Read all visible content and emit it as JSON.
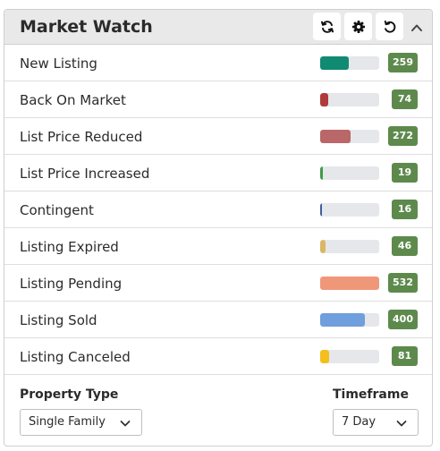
{
  "widget": {
    "title": "Market Watch",
    "header_icons": [
      "refresh-icon",
      "gear-icon",
      "undo-icon",
      "chevron-up-icon"
    ]
  },
  "rows": [
    {
      "label": "New Listing",
      "count": "259",
      "fill": 0.49,
      "color": "#118a72"
    },
    {
      "label": "Back On Market",
      "count": "74",
      "fill": 0.14,
      "color": "#b03a3a"
    },
    {
      "label": "List Price Reduced",
      "count": "272",
      "fill": 0.51,
      "color": "#b96768"
    },
    {
      "label": "List Price Increased",
      "count": "19",
      "fill": 0.04,
      "color": "#3f9b4a"
    },
    {
      "label": "Contingent",
      "count": "16",
      "fill": 0.03,
      "color": "#3d5f9e"
    },
    {
      "label": "Listing Expired",
      "count": "46",
      "fill": 0.09,
      "color": "#d9b766"
    },
    {
      "label": "Listing Pending",
      "count": "532",
      "fill": 1.0,
      "color": "#f0977a"
    },
    {
      "label": "Listing Sold",
      "count": "400",
      "fill": 0.75,
      "color": "#6f9fdc"
    },
    {
      "label": "Listing Canceled",
      "count": "81",
      "fill": 0.15,
      "color": "#f4bf1c"
    }
  ],
  "footer": {
    "property_type_label": "Property Type",
    "property_type_value": "Single Family",
    "timeframe_label": "Timeframe",
    "timeframe_value": "7 Day"
  },
  "colors": {
    "badge": "#5d8a4c",
    "header_bg": "#e9e9e9",
    "bar_track": "#e5e7ea"
  }
}
